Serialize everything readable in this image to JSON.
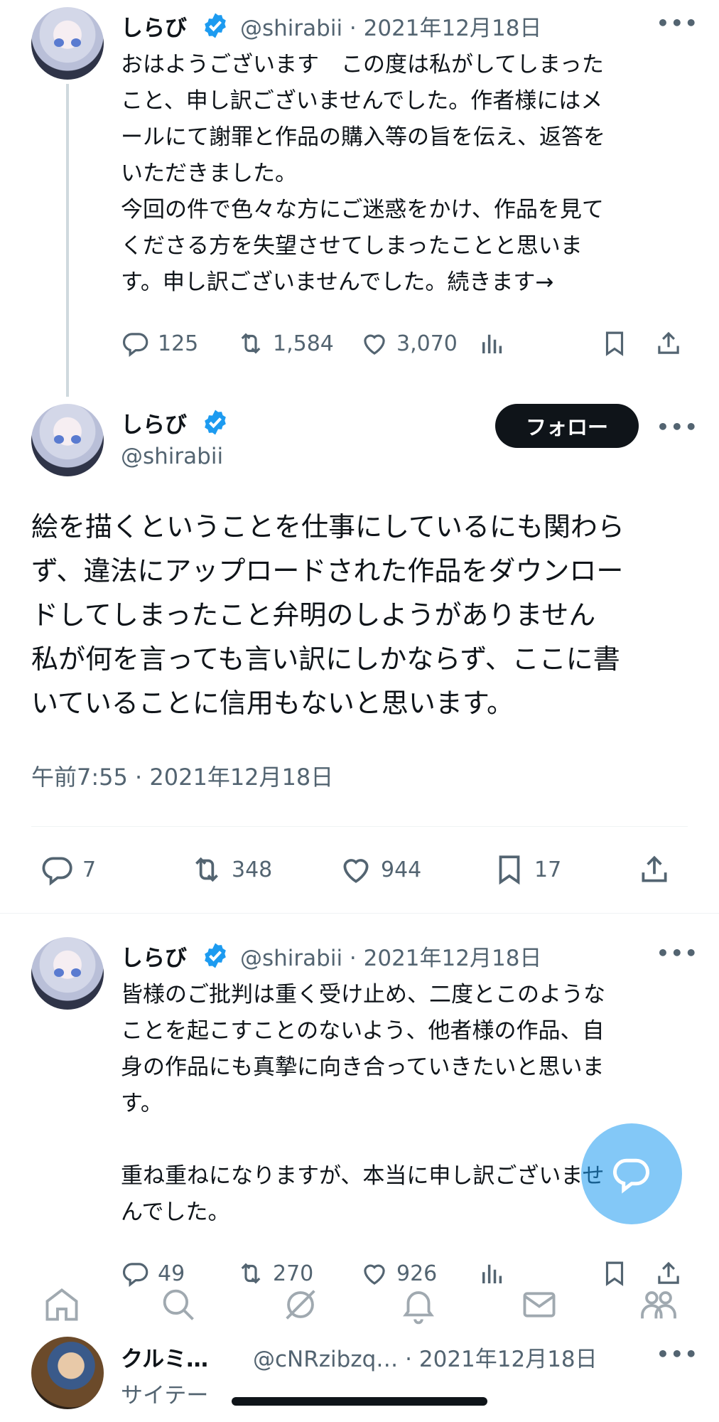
{
  "tweet1": {
    "name": "しらび",
    "handle": "@shirabii",
    "date": "2021年12月18日",
    "lines": [
      "おはようございます　この度は私がしてしまった",
      "こと、申し訳ございませんでした。作者様にはメ",
      "ールにて謝罪と作品の購入等の旨を伝え、返答を",
      "いただきました。",
      "今回の件で色々な方にご迷惑をかけ、作品を見て",
      "くださる方を失望させてしまったことと思いま",
      "す。申し訳ございませんでした。続きます→"
    ],
    "replies": "125",
    "retweets": "1,584",
    "likes": "3,070"
  },
  "main_tweet": {
    "name": "しらび",
    "handle": "@shirabii",
    "follow_label": "フォロー",
    "lines": [
      "絵を描くということを仕事にしているにも関わら",
      "ず、違法にアップロードされた作品をダウンロー",
      "ドしてしまったこと弁明のしようがありません",
      "私が何を言っても言い訳にしかならず、ここに書",
      "いていることに信用もないと思います。"
    ],
    "timestamp": "午前7:55 · 2021年12月18日",
    "replies": "7",
    "retweets": "348",
    "likes": "944",
    "bookmarks": "17"
  },
  "tweet3": {
    "name": "しらび",
    "handle": "@shirabii",
    "date": "2021年12月18日",
    "lines": [
      "皆様のご批判は重く受け止め、二度とこのような",
      "ことを起こすことのないよう、他者様の作品、自",
      "身の作品にも真摯に向き合っていきたいと思いま",
      "す。",
      "",
      "重ね重ねになりますが、本当に申し訳ございませ",
      "んでした。"
    ],
    "replies": "49",
    "retweets": "270",
    "likes": "926"
  },
  "tweet4": {
    "name": "クルミ…",
    "handle": "@cNRzibzq…",
    "date": "2021年12月18日",
    "preview": "サイテー"
  },
  "separator": "·",
  "colors": {
    "accent": "#1d9bf0",
    "text": "#0f1419",
    "secondary": "#536471",
    "divider": "#eff3f4"
  },
  "icons": {
    "tabs": [
      "home-icon",
      "search-icon",
      "grok-icon",
      "notifications-icon",
      "messages-icon",
      "communities-icon"
    ]
  }
}
